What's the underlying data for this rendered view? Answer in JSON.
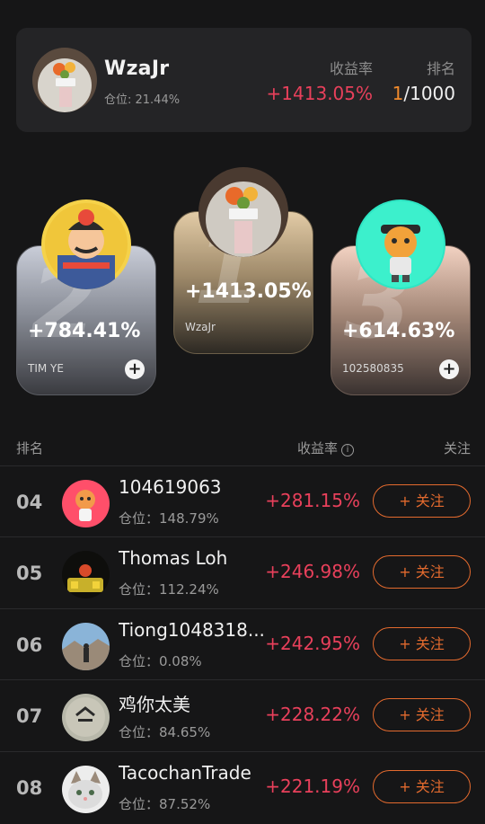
{
  "me": {
    "name": "WzaJr",
    "position": "仓位: 21.44%",
    "rate_label": "收益率",
    "rank_label": "排名",
    "rate": "+1413.05%",
    "rank_current": "1",
    "rank_total": "/1000"
  },
  "podium": [
    {
      "place": "2",
      "rate": "+784.41%",
      "name": "TIM YE"
    },
    {
      "place": "1",
      "rate": "+1413.05%",
      "name": "WzaJr"
    },
    {
      "place": "3",
      "rate": "+614.63%",
      "name": "102580835"
    }
  ],
  "podium_follow_glyph": "+",
  "list_header": {
    "rank": "排名",
    "rate": "收益率",
    "info_glyph": "i",
    "follow": "关注"
  },
  "rows": [
    {
      "rank": "04",
      "name": "104619063",
      "position": "仓位：148.79%",
      "rate": "+281.15%",
      "button": "+ 关注"
    },
    {
      "rank": "05",
      "name": "Thomas Loh",
      "position": "仓位：112.24%",
      "rate": "+246.98%",
      "button": "+ 关注"
    },
    {
      "rank": "06",
      "name": "Tiong1048318...",
      "position": "仓位：0.08%",
      "rate": "+242.95%",
      "button": "+ 关注"
    },
    {
      "rank": "07",
      "name": "鸡你太美",
      "position": "仓位：84.65%",
      "rate": "+228.22%",
      "button": "+ 关注"
    },
    {
      "rank": "08",
      "name": "TacochanTrade",
      "position": "仓位：87.52%",
      "rate": "+221.19%",
      "button": "+ 关注"
    }
  ],
  "colors": {
    "accent_red": "#e8405b",
    "accent_orange": "#e36a2e",
    "rank_orange": "#f08a2c",
    "background": "#161617"
  }
}
